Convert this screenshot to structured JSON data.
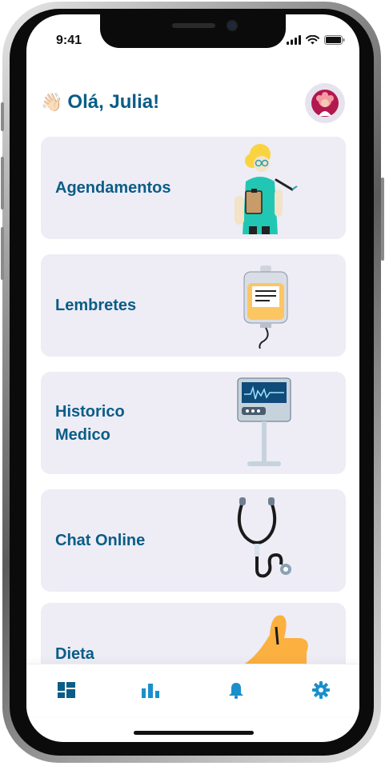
{
  "status_bar": {
    "time": "9:41"
  },
  "greeting": {
    "emoji": "👋🏻",
    "text": "Olá, Julia!"
  },
  "menu": [
    {
      "label": "Agendamentos",
      "icon": "doctor-illustration"
    },
    {
      "label": "Lembretes",
      "icon": "iv-bag-illustration"
    },
    {
      "label_line1": "Historico",
      "label_line2": "Medico",
      "icon": "monitor-illustration"
    },
    {
      "label": "Chat Online",
      "icon": "stethoscope-illustration"
    },
    {
      "label": "Dieta",
      "icon": "thumbs-up-illustration"
    }
  ],
  "tab_bar": [
    {
      "icon": "dashboard-icon"
    },
    {
      "icon": "bar-chart-icon"
    },
    {
      "icon": "bell-icon"
    },
    {
      "icon": "gear-icon"
    }
  ],
  "colors": {
    "accent": "#0a5d86",
    "tab_icon": "#1a8fcb",
    "card_bg": "#eeecf5"
  }
}
